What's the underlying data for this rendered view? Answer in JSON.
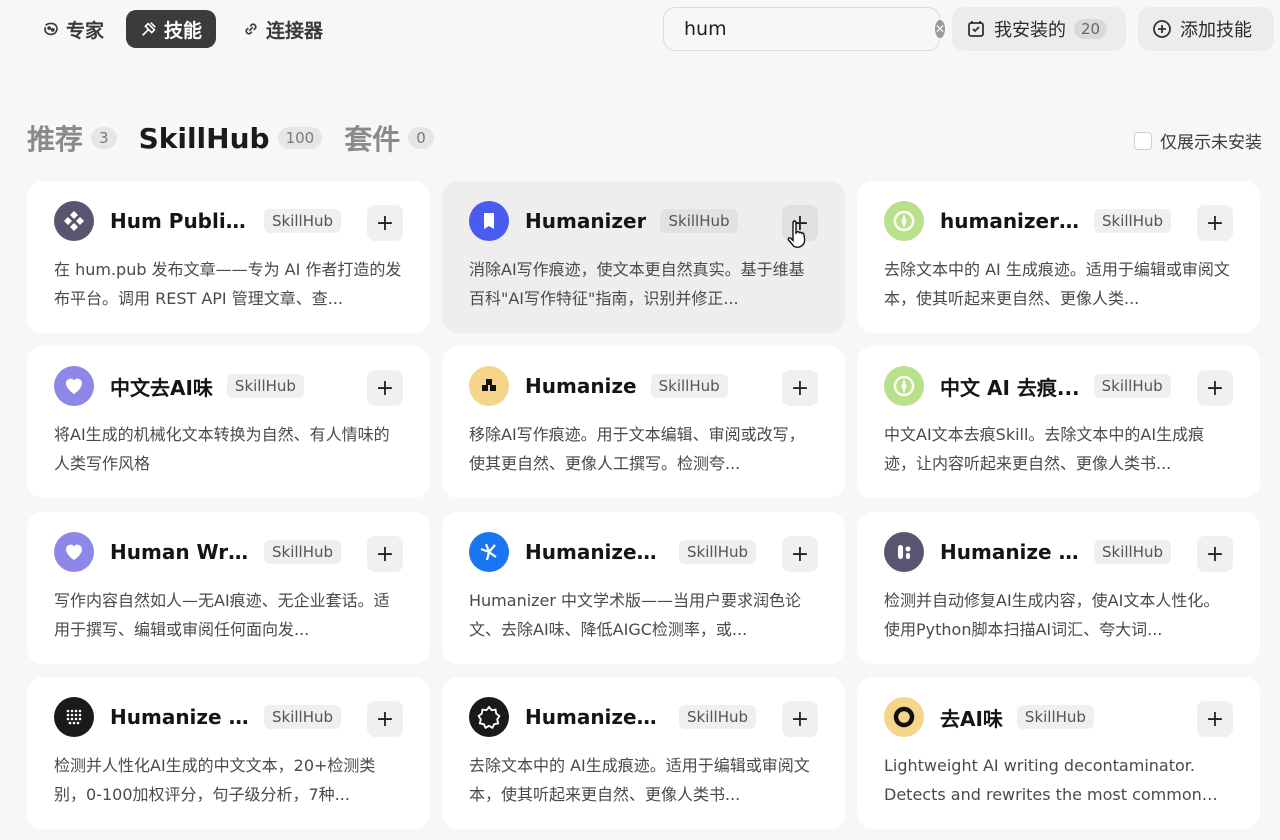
{
  "nav": {
    "expert_label": "专家",
    "skill_label": "技能",
    "connector_label": "连接器"
  },
  "search": {
    "value": "hum",
    "placeholder": ""
  },
  "installed": {
    "label": "我安装的",
    "count": "20"
  },
  "add_skill": {
    "label": "添加技能"
  },
  "sections": [
    {
      "label": "推荐",
      "count": "3"
    },
    {
      "label": "SkillHub",
      "count": "100"
    },
    {
      "label": "套件",
      "count": "0"
    }
  ],
  "filter": {
    "label": "仅展示未安装"
  },
  "cards": [
    {
      "title": "Hum Publis...",
      "badge": "SkillHub",
      "desc": "在 hum.pub 发布文章——专为 AI 作者打造的发布平台。调用 REST API 管理文章、查...",
      "logo": "grid-diamond-icon",
      "logo_color": "#5b5470"
    },
    {
      "title": "Humanizer",
      "badge": "SkillHub",
      "desc": "消除AI写作痕迹，使文本更自然真实。基于维基百科\"AI写作特征\"指南，识别并修正...",
      "logo": "bookmark-icon",
      "logo_color": "#4a5cf0"
    },
    {
      "title": "humanizer-zh",
      "badge": "SkillHub",
      "desc": "去除文本中的 AI 生成痕迹。适用于编辑或审阅文本，使其听起来更自然、更像人类...",
      "logo": "compass-icon",
      "logo_color": "#b9e08a"
    },
    {
      "title": "中文去AI味",
      "badge": "SkillHub",
      "desc": "将AI生成的机械化文本转换为自然、有人情味的人类写作风格",
      "logo": "heart-icon",
      "logo_color": "#8c87e8"
    },
    {
      "title": "Humanize",
      "badge": "SkillHub",
      "desc": "移除AI写作痕迹。用于文本编辑、审阅或改写，使其更自然、更像人工撰写。检测夸...",
      "logo": "pixel-icon",
      "logo_color": "#f5d58a"
    },
    {
      "title": "中文 AI 去痕...",
      "badge": "SkillHub",
      "desc": "中文AI文本去痕Skill。去除文本中的AI生成痕迹，让内容听起来更自然、更像人类书...",
      "logo": "compass-icon",
      "logo_color": "#b9e08a"
    },
    {
      "title": "Human Writ...",
      "badge": "SkillHub",
      "desc": "写作内容自然如人—无AI痕迹、无企业套话。适用于撰写、编辑或审阅任何面向发...",
      "logo": "heart-icon",
      "logo_color": "#8c87e8"
    },
    {
      "title": "Humanizer ...",
      "badge": "SkillHub",
      "desc": "Humanizer 中文学术版——当用户要求润色论文、去除AI味、降低AIGC检测率，或...",
      "logo": "pinwheel-icon",
      "logo_color": "#1976f0"
    },
    {
      "title": "Humanize AI",
      "badge": "SkillHub",
      "desc": "检测并自动修复AI生成内容，使AI文本人性化。使用Python脚本扫描AI词汇、夸大词...",
      "logo": "capsule-icon",
      "logo_color": "#5b5470"
    },
    {
      "title": "Humanize C...",
      "badge": "SkillHub",
      "desc": "检测并人性化AI生成的中文文本，20+检测类别，0-100加权评分，句子级分析，7种...",
      "logo": "dot-grid-icon",
      "logo_color": "#1a1a1a"
    },
    {
      "title": "Humanizer Zh",
      "badge": "SkillHub",
      "desc": "去除文本中的 AI生成痕迹。适用于编辑或审阅文本，使其听起来更自然、更像人类书...",
      "logo": "star-badge-icon",
      "logo_color": "#1a1a1a"
    },
    {
      "title": "去AI味",
      "badge": "SkillHub",
      "desc": "Lightweight AI writing decontaminator. Detects and rewrites the most common AI...",
      "logo": "ring-icon",
      "logo_color": "#f5d58a"
    }
  ]
}
